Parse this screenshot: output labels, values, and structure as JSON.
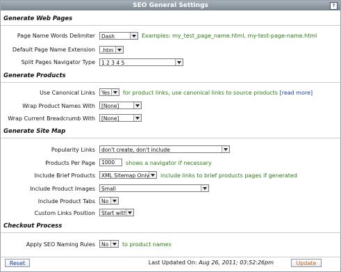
{
  "window": {
    "title": "SEO General Settings",
    "help_icon": "help-icon"
  },
  "sections": {
    "web_pages": "Generate Web Pages",
    "products": "Generate Products",
    "site_map": "Generate Site Map",
    "checkout": "Checkout Process"
  },
  "web_pages": {
    "delimiter_label": "Page Name Words Delimiter",
    "delimiter_value": "Dash",
    "delimiter_note": "Examples: my_test_page_name.html, my-test-page-name.html",
    "extension_label": "Default Page Name Extension",
    "extension_value": ".htm",
    "navigator_label": "Split Pages Navigator Type",
    "navigator_value": "1 2 3 4 5"
  },
  "products": {
    "canonical_label": "Use Canonical Links",
    "canonical_value": "Yes",
    "canonical_note": "for product links, use canonical links to source products",
    "read_more": "[read more]",
    "wrap_names_label": "Wrap Product Names With",
    "wrap_names_value": "[None]",
    "wrap_breadcrumb_label": "Wrap Current Breadcrumb With",
    "wrap_breadcrumb_value": "[None]"
  },
  "site_map": {
    "popularity_label": "Popularity Links",
    "popularity_value": "don't create, don't include",
    "per_page_label": "Products Per Page",
    "per_page_value": "1000",
    "per_page_note": "shows a navigator if necessary",
    "brief_label": "Include Brief Products",
    "brief_value": "XML Sitemap Only",
    "brief_note": "include links to brief products pages if generated",
    "images_label": "Include Product Images",
    "images_value": "Small",
    "tabs_label": "Include Product Tabs",
    "tabs_value": "No",
    "custom_label": "Custom Links Position",
    "custom_value": "Start with"
  },
  "checkout": {
    "naming_label": "Apply SEO Naming Rules",
    "naming_value": "No",
    "naming_note": "to product names"
  },
  "footer": {
    "reset": "Reset",
    "updated_label": "Last Updated On:",
    "updated_value": "Aug 26, 2011; 03:52:26pm",
    "update": "Update"
  }
}
